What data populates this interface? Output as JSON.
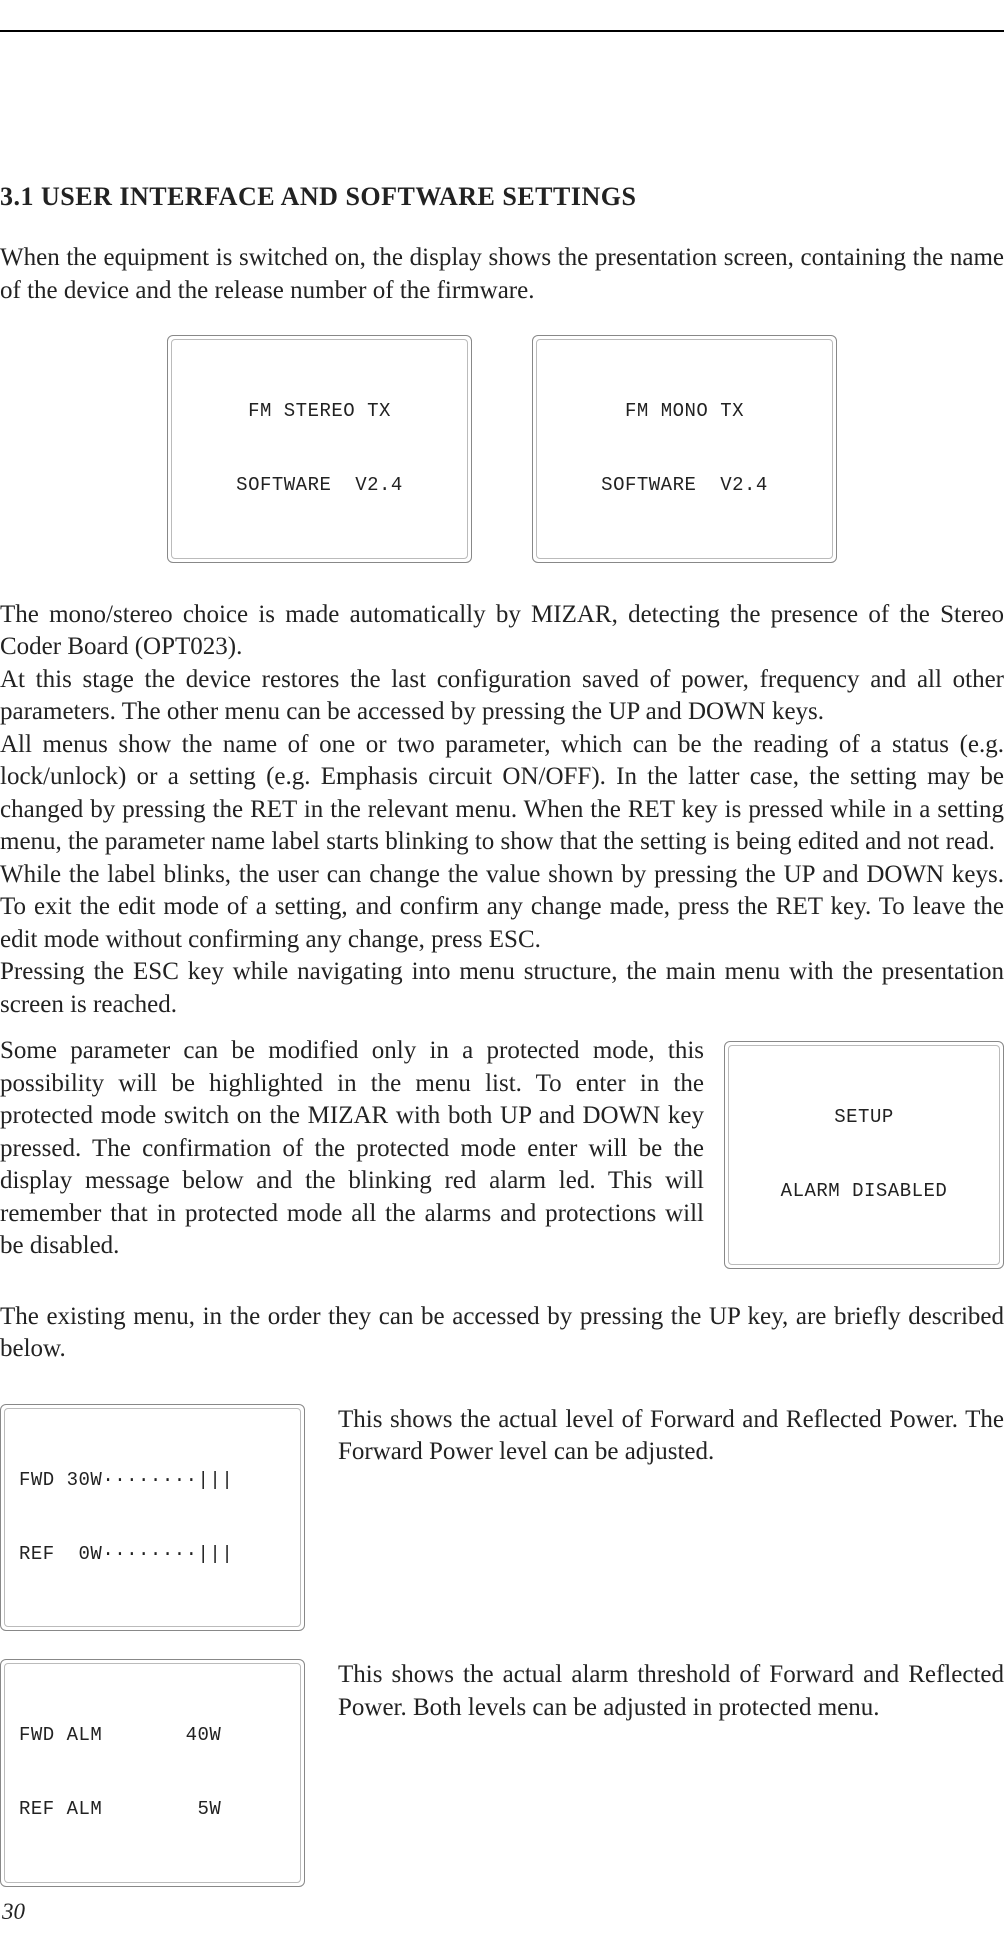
{
  "section_title": "3.1 USER INTERFACE AND SOFTWARE SETTINGS",
  "intro_para": "When the equipment is switched on, the display shows the presentation screen, containing the name of the device and the release number of the firmware.",
  "lcd_stereo": {
    "line1": "FM STEREO TX",
    "line2": "SOFTWARE  V2.4"
  },
  "lcd_mono": {
    "line1": "FM MONO TX",
    "line2": "SOFTWARE  V2.4"
  },
  "para_block": "The mono/stereo choice is made automatically by MIZAR, detecting the presence of the Stereo Coder Board (OPT023).\nAt this stage the device restores the last configuration saved of power, frequency and all other parameters. The other menu can be accessed by pressing the UP and DOWN keys.\nAll menus show the name of one or two parameter, which can be the reading of a status (e.g. lock/unlock) or a setting (e.g. Emphasis circuit ON/OFF). In the latter case, the setting may be changed by pressing the RET in the relevant menu. When the RET key is pressed while in a setting menu, the parameter name label starts blinking to show that the setting is being edited and not read.\nWhile the label blinks, the user can change the value shown by pressing the UP and DOWN keys. To exit the edit mode of a setting, and confirm any change made, press the RET key. To leave the edit mode without confirming any change, press ESC.\nPressing the ESC key while navigating into menu structure, the main menu with the presentation screen is reached.",
  "para_protected": "Some parameter can be modified only in a protected mode, this possibility will be highlighted in the menu list. To enter in the protected mode switch on the MIZAR with both UP and DOWN key pressed. The confirmation of the protected mode enter will be the display message below and the blinking red alarm led. This will remember that in protected mode all the alarms and protections will be disabled.",
  "lcd_setup": {
    "line1": "SETUP",
    "line2": "ALARM DISABLED"
  },
  "para_menu_intro": "The existing menu, in the order they can be accessed by pressing the UP key, are briefly described below.",
  "menu1": {
    "lcd_line1": "FWD 30W········|||",
    "lcd_line2": "REF  0W········|||",
    "desc": "This shows the actual level of Forward and Reflected Power. The Forward Power level can be adjusted."
  },
  "menu2": {
    "lcd_line1": "FWD ALM       40W",
    "lcd_line2": "REF ALM        5W",
    "desc": "This shows the actual alarm threshold of Forward and Reflected Power. Both levels can be adjusted in protected menu."
  },
  "page_number": "30"
}
